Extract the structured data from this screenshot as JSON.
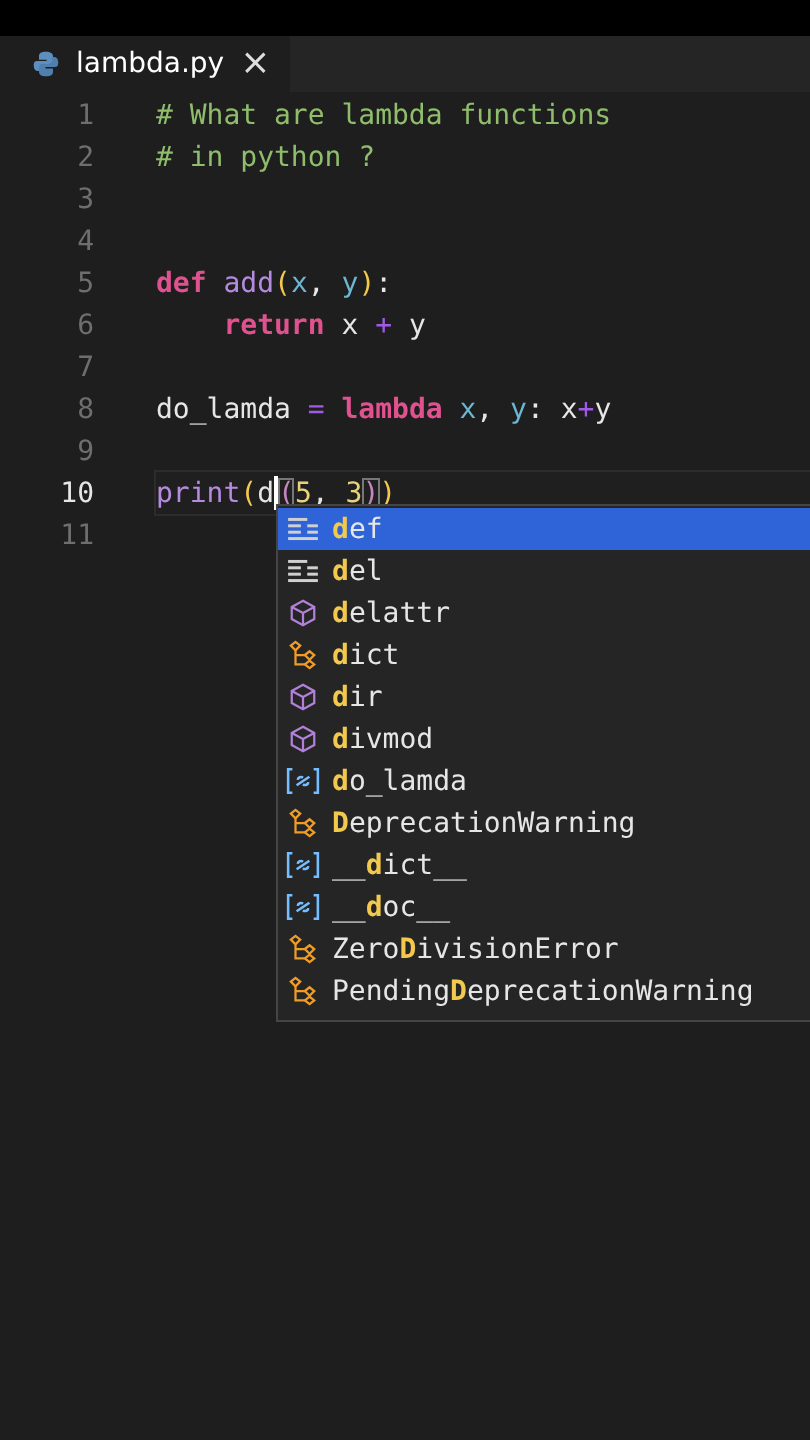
{
  "tab": {
    "title": "lambda.py",
    "close": "×"
  },
  "lines": [
    {
      "number": "1",
      "current": false,
      "tokens": [
        {
          "text": "# What are lambda functions",
          "kind": "comment"
        }
      ]
    },
    {
      "number": "2",
      "current": false,
      "tokens": [
        {
          "text": "# in python ?",
          "kind": "comment"
        }
      ]
    },
    {
      "number": "3",
      "current": false
    },
    {
      "number": "4",
      "current": false
    },
    {
      "number": "5",
      "current": false,
      "tokens": [
        {
          "text": "def",
          "kind": "keyword"
        },
        {
          "text": " add",
          "kind": "function"
        },
        {
          "text": "(",
          "kind": "paren"
        },
        {
          "text": "x",
          "kind": "param"
        },
        {
          "text": ", ",
          "kind": "plain"
        },
        {
          "text": "y",
          "kind": "param"
        },
        {
          "text": ")",
          "kind": "paren"
        },
        {
          "text": ":",
          "kind": "plain"
        }
      ]
    },
    {
      "number": "6",
      "current": false,
      "tokens": [
        {
          "text": "    return",
          "kind": "keyword"
        },
        {
          "text": " x ",
          "kind": "plain"
        },
        {
          "text": "+",
          "kind": "operator"
        },
        {
          "text": " y",
          "kind": "plain"
        }
      ]
    },
    {
      "number": "7",
      "current": false
    },
    {
      "number": "8",
      "current": false,
      "tokens": [
        {
          "text": "do_lamda ",
          "kind": "plain"
        },
        {
          "text": "=",
          "kind": "operator"
        },
        {
          "text": " lambda",
          "kind": "keyword"
        },
        {
          "text": " x",
          "kind": "param"
        },
        {
          "text": ", ",
          "kind": "plain"
        },
        {
          "text": "y",
          "kind": "param"
        },
        {
          "text": ": x",
          "kind": "plain"
        },
        {
          "text": "+",
          "kind": "operator"
        },
        {
          "text": "y",
          "kind": "plain"
        }
      ]
    },
    {
      "number": "9",
      "current": false
    },
    {
      "number": "10",
      "current": true,
      "tokens": [
        {
          "text": "print",
          "kind": "function"
        },
        {
          "text": "(",
          "kind": "paren"
        },
        {
          "text": "d",
          "kind": "plain",
          "cursor_after": true
        },
        {
          "text": "(",
          "kind": "paren2",
          "boxed": true
        },
        {
          "text": "5",
          "kind": "number"
        },
        {
          "text": ", ",
          "kind": "plain"
        },
        {
          "text": "3",
          "kind": "number"
        },
        {
          "text": ")",
          "kind": "paren2",
          "boxed": true
        },
        {
          "text": ")",
          "kind": "paren"
        }
      ]
    },
    {
      "number": "11",
      "current": false
    }
  ],
  "suggestions": [
    {
      "label": "**d**ef",
      "kind": "keyword",
      "selected": true
    },
    {
      "label": "**d**el",
      "kind": "keyword",
      "selected": false
    },
    {
      "label": "**d**elattr",
      "kind": "function",
      "selected": false
    },
    {
      "label": "**d**ict",
      "kind": "class",
      "selected": false
    },
    {
      "label": "**d**ir",
      "kind": "function",
      "selected": false
    },
    {
      "label": "**d**ivmod",
      "kind": "function",
      "selected": false
    },
    {
      "label": "**d**o_lamda",
      "kind": "variable",
      "selected": false
    },
    {
      "label": "**D**eprecationWarning",
      "kind": "class",
      "selected": false
    },
    {
      "label": "__**d**ict__",
      "kind": "variable",
      "selected": false
    },
    {
      "label": "__**d**oc__",
      "kind": "variable",
      "selected": false
    },
    {
      "label": "Zero**D**ivisionError",
      "kind": "class",
      "selected": false
    },
    {
      "label": "Pending**D**eprecationWarning",
      "kind": "class",
      "selected": false
    }
  ]
}
